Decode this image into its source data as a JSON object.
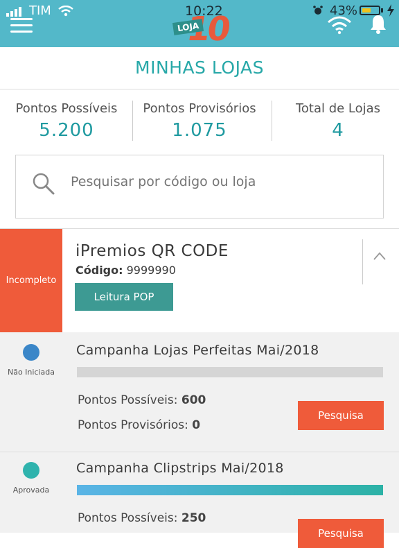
{
  "status_bar": {
    "carrier": "TIM",
    "time": "10:22",
    "battery": "43%"
  },
  "header": {
    "logo_text": "LOJA 10"
  },
  "page": {
    "title": "MINHAS LOJAS"
  },
  "stats": [
    {
      "label": "Pontos Possíveis",
      "value": "5.200"
    },
    {
      "label": "Pontos Provisórios",
      "value": "1.075"
    },
    {
      "label": "Total de Lojas",
      "value": "4"
    }
  ],
  "search": {
    "placeholder": "Pesquisar por código ou loja"
  },
  "store": {
    "status": "Incompleto",
    "name": "iPremios QR CODE",
    "code_label": "Código:",
    "code_value": "9999990",
    "button": "Leitura POP"
  },
  "campaigns": [
    {
      "status": "Não Iniciada",
      "status_color": "#3a86c8",
      "title": "Campanha Lojas Perfeitas Mai/2018",
      "progress": 0,
      "points_possible_label": "Pontos Possíveis:",
      "points_possible": "600",
      "points_provisional_label": "Pontos Provisórios:",
      "points_provisional": "0",
      "button": "Pesquisa"
    },
    {
      "status": "Aprovada",
      "status_color": "#2fb3ad",
      "title": "Campanha Clipstrips Mai/2018",
      "progress": 1.0,
      "points_possible_label": "Pontos Possíveis:",
      "points_possible": "250",
      "button": "Pesquisa"
    }
  ],
  "colors": {
    "header": "#53b8c9",
    "accent_teal": "#1f9aa0",
    "status_incomplete": "#ef5b3a",
    "button_orange": "#ef5b3a"
  }
}
